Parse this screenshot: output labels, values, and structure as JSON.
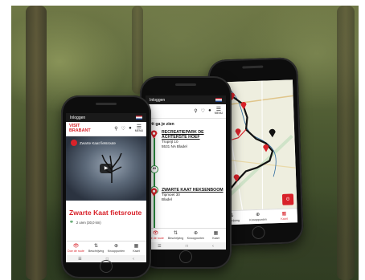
{
  "phones": {
    "left": {
      "status_text": "Inloggen",
      "logo_line1": "VISIT",
      "logo_line2": "BRABANT",
      "menu_label": "MENU",
      "video_title": "Zwarte Kaat fietsroute",
      "route_title": "Zwarte Kaat fietsroute",
      "route_meta": "2 uren (30,0 km)",
      "tabs": [
        {
          "icon": "👁",
          "label": "Doe de route"
        },
        {
          "icon": "⇅",
          "label": "Beschrijving"
        },
        {
          "icon": "⊕",
          "label": "Knooppunten"
        },
        {
          "icon": "▦",
          "label": "Kaart"
        }
      ]
    },
    "middle": {
      "status_text": "Inloggen",
      "menu_label": "MENU",
      "heading": "Dit ga je zien",
      "pois": [
        {
          "name": "RECREATIEPARK DE ACHTERSTE HOEF",
          "line1": "Troprijt 10",
          "line2": "5531 NA Bladel"
        },
        {
          "name": "ZWARTE KAAT HEKSENBOOM",
          "line1": "Tipmoet 30",
          "line2": "Bladel"
        }
      ],
      "nodes": [
        "83",
        "3"
      ],
      "tabs": [
        {
          "icon": "👁",
          "label": "Doe de route"
        },
        {
          "icon": "⇅",
          "label": "Beschrijving"
        },
        {
          "icon": "⊕",
          "label": "Knooppunten"
        },
        {
          "icon": "▦",
          "label": "Kaart"
        }
      ]
    },
    "right": {
      "tabs": [
        {
          "icon": "⇅",
          "label": "Beschrijving"
        },
        {
          "icon": "⊕",
          "label": "Knooppunten"
        },
        {
          "icon": "▦",
          "label": "Kaart"
        }
      ],
      "map_button_icon": "⊙"
    }
  },
  "colors": {
    "brand_red": "#d8222a",
    "route_green": "#2b8a3e",
    "route_black": "#111111"
  },
  "icons": [
    "search-icon",
    "heart-icon",
    "location-pin-icon",
    "menu-icon",
    "play-icon",
    "bike-icon",
    "eye-icon"
  ]
}
